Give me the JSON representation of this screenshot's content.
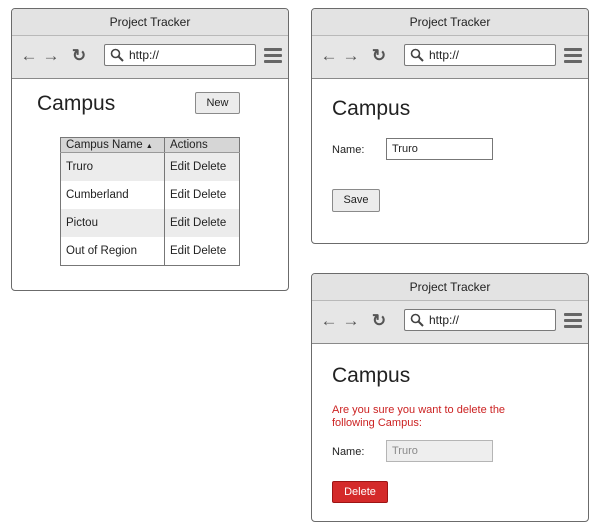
{
  "window_title": "Project Tracker",
  "url": "http://",
  "page_heading": "Campus",
  "list_view": {
    "new_button": "New",
    "columns": [
      "Campus Name",
      "Actions"
    ],
    "sort_indicator": "▲",
    "rows": [
      {
        "name": "Truro",
        "edit": "Edit",
        "delete": "Delete"
      },
      {
        "name": "Cumberland",
        "edit": "Edit",
        "delete": "Delete"
      },
      {
        "name": "Pictou",
        "edit": "Edit",
        "delete": "Delete"
      },
      {
        "name": "Out of Region",
        "edit": "Edit",
        "delete": "Delete"
      }
    ]
  },
  "edit_view": {
    "name_label": "Name:",
    "name_value": "Truro",
    "save_button": "Save"
  },
  "delete_view": {
    "confirm_message": "Are you sure you want to delete the following Campus:",
    "name_label": "Name:",
    "name_value": "Truro",
    "delete_button": "Delete"
  },
  "colors": {
    "danger": "#d42a2a",
    "warning_text": "#cc2222",
    "chrome": "#e3e3e3"
  },
  "icons": [
    "back-arrow-icon",
    "forward-arrow-icon",
    "reload-icon",
    "search-icon",
    "hamburger-menu-icon"
  ]
}
